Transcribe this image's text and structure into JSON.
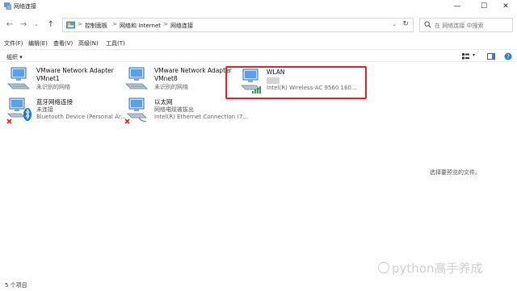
{
  "window": {
    "title": "网络连接",
    "minimize": "—",
    "maximize": "☐",
    "close": "✕"
  },
  "address": {
    "crumbs": [
      "控制面板",
      "网络和 Internet",
      "网络连接"
    ],
    "separator": ">",
    "search_placeholder": "在 网络连接 中搜索"
  },
  "menu": [
    "文件(F)",
    "编辑(E)",
    "查看(V)",
    "高级(N)",
    "工具(T)"
  ],
  "toolbar": {
    "organize": "组织 ▾"
  },
  "connections": [
    {
      "name": "VMware Network Adapter",
      "name2": "VMnet1",
      "status": "未识别的网络",
      "device": ""
    },
    {
      "name": "VMware Network Adapter",
      "name2": "VMnet8",
      "status": "未识别的网络",
      "device": ""
    },
    {
      "name": "WLAN",
      "status": "",
      "device": "Intel(R) Wireless-AC 9560 160..."
    },
    {
      "name": "蓝牙网络连接",
      "status": "未连接",
      "device": "Bluetooth Device (Personal Ar..."
    },
    {
      "name": "以太网",
      "status": "网络电缆被拔出",
      "device": "Intel(R) Ethernet Connection (7..."
    }
  ],
  "preview": {
    "message": "选择要预览的文件。"
  },
  "status": {
    "count": "5 个项目"
  },
  "watermark": "python高手养成",
  "colors": {
    "highlight": "#e02424",
    "network_blue": "#2f7fd0",
    "signal_green": "#2ea043",
    "error_red": "#d32f2f",
    "bluetooth_blue": "#1976d2"
  }
}
